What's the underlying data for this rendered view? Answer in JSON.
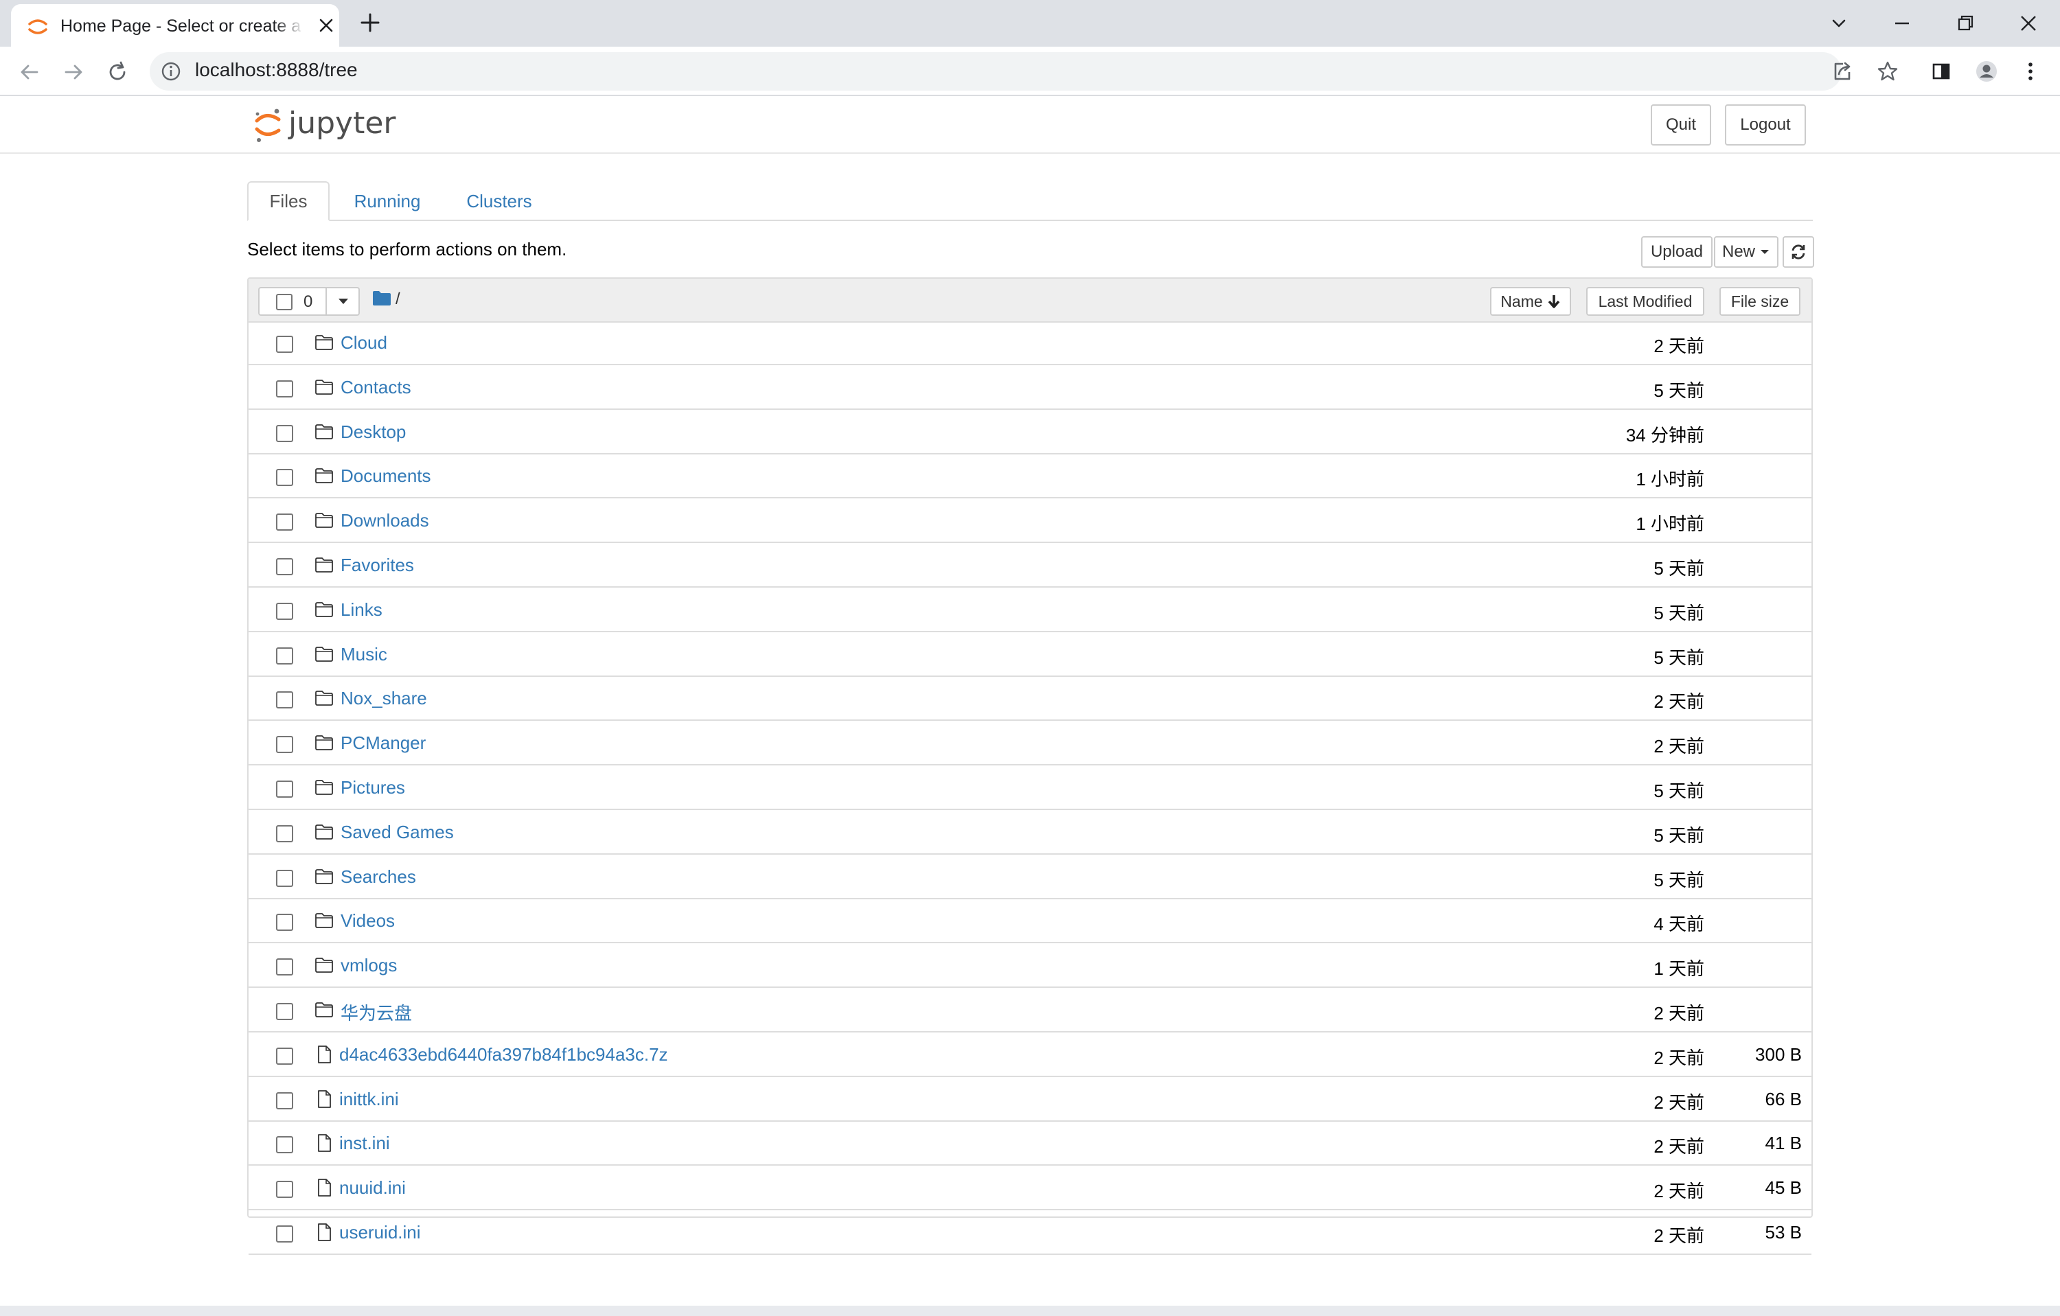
{
  "browser": {
    "tab_title": "Home Page - Select or create a notebook",
    "url": "localhost:8888/tree"
  },
  "header": {
    "logo_text": "jupyter",
    "quit_label": "Quit",
    "logout_label": "Logout"
  },
  "tabs": [
    {
      "label": "Files",
      "active": true
    },
    {
      "label": "Running",
      "active": false
    },
    {
      "label": "Clusters",
      "active": false
    }
  ],
  "toolbar": {
    "instructions": "Select items to perform actions on them.",
    "upload_label": "Upload",
    "new_label": "New"
  },
  "list_header": {
    "selected_count": "0",
    "breadcrumb": "/",
    "col_name": "Name",
    "col_modified": "Last Modified",
    "col_size": "File size"
  },
  "rows": [
    {
      "type": "folder",
      "name": "Cloud",
      "modified": "2 天前",
      "size": ""
    },
    {
      "type": "folder",
      "name": "Contacts",
      "modified": "5 天前",
      "size": ""
    },
    {
      "type": "folder",
      "name": "Desktop",
      "modified": "34 分钟前",
      "size": ""
    },
    {
      "type": "folder",
      "name": "Documents",
      "modified": "1 小时前",
      "size": ""
    },
    {
      "type": "folder",
      "name": "Downloads",
      "modified": "1 小时前",
      "size": ""
    },
    {
      "type": "folder",
      "name": "Favorites",
      "modified": "5 天前",
      "size": ""
    },
    {
      "type": "folder",
      "name": "Links",
      "modified": "5 天前",
      "size": ""
    },
    {
      "type": "folder",
      "name": "Music",
      "modified": "5 天前",
      "size": ""
    },
    {
      "type": "folder",
      "name": "Nox_share",
      "modified": "2 天前",
      "size": ""
    },
    {
      "type": "folder",
      "name": "PCManger",
      "modified": "2 天前",
      "size": ""
    },
    {
      "type": "folder",
      "name": "Pictures",
      "modified": "5 天前",
      "size": ""
    },
    {
      "type": "folder",
      "name": "Saved Games",
      "modified": "5 天前",
      "size": ""
    },
    {
      "type": "folder",
      "name": "Searches",
      "modified": "5 天前",
      "size": ""
    },
    {
      "type": "folder",
      "name": "Videos",
      "modified": "4 天前",
      "size": ""
    },
    {
      "type": "folder",
      "name": "vmlogs",
      "modified": "1 天前",
      "size": ""
    },
    {
      "type": "folder",
      "name": "华为云盘",
      "modified": "2 天前",
      "size": ""
    },
    {
      "type": "file",
      "name": "d4ac4633ebd6440fa397b84f1bc94a3c.7z",
      "modified": "2 天前",
      "size": "300 B"
    },
    {
      "type": "file",
      "name": "inittk.ini",
      "modified": "2 天前",
      "size": "66 B"
    },
    {
      "type": "file",
      "name": "inst.ini",
      "modified": "2 天前",
      "size": "41 B"
    },
    {
      "type": "file",
      "name": "nuuid.ini",
      "modified": "2 天前",
      "size": "45 B"
    },
    {
      "type": "file",
      "name": "useruid.ini",
      "modified": "2 天前",
      "size": "53 B"
    }
  ],
  "colors": {
    "link": "#337ab7",
    "jupyter_orange": "#f37726"
  }
}
